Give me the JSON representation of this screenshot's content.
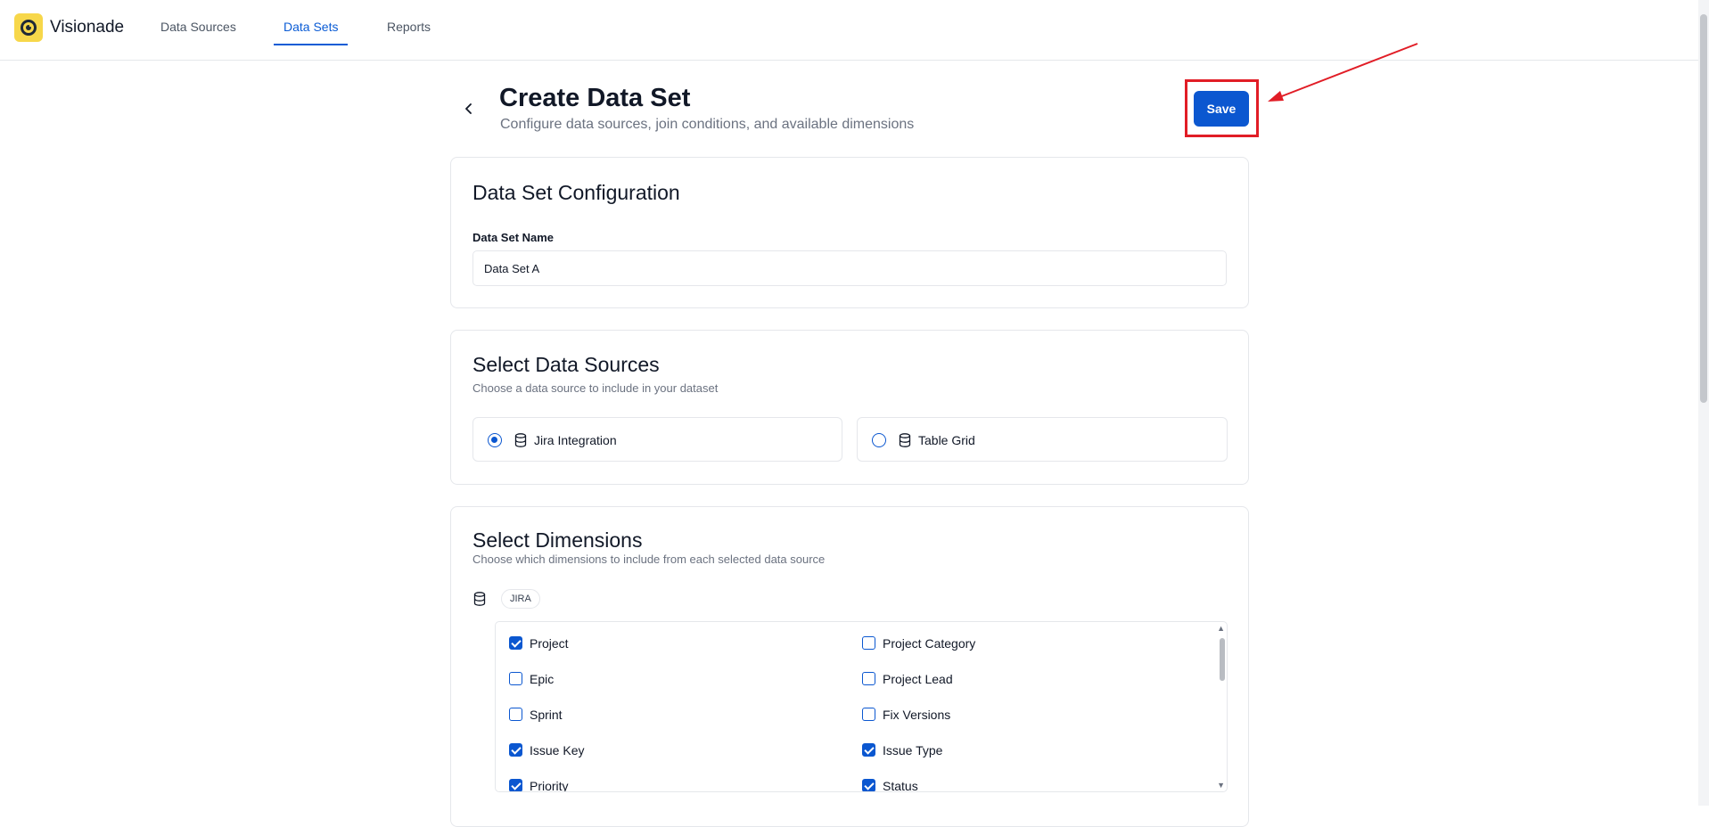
{
  "app": {
    "name": "Visionade"
  },
  "nav": {
    "tabs": [
      {
        "label": "Data Sources"
      },
      {
        "label": "Data Sets"
      },
      {
        "label": "Reports"
      }
    ],
    "active_tab": "Data Sets"
  },
  "header": {
    "title": "Create Data Set",
    "subtitle": "Configure data sources, join conditions, and available dimensions",
    "save_label": "Save"
  },
  "config": {
    "title": "Data Set Configuration",
    "name_label": "Data Set Name",
    "name_value": "Data Set A"
  },
  "sources": {
    "title": "Select Data Sources",
    "description": "Choose a data source to include in your dataset",
    "options": [
      {
        "label": "Jira Integration",
        "selected": true
      },
      {
        "label": "Table Grid",
        "selected": false
      }
    ]
  },
  "dimensions": {
    "title": "Select Dimensions",
    "description": "Choose which dimensions to include from each selected data source",
    "source_tag": "JIRA",
    "items": [
      {
        "label": "Project",
        "checked": true
      },
      {
        "label": "Project Category",
        "checked": false
      },
      {
        "label": "Epic",
        "checked": false
      },
      {
        "label": "Project Lead",
        "checked": false
      },
      {
        "label": "Sprint",
        "checked": false
      },
      {
        "label": "Fix Versions",
        "checked": false
      },
      {
        "label": "Issue Key",
        "checked": true
      },
      {
        "label": "Issue Type",
        "checked": true
      },
      {
        "label": "Priority",
        "checked": true
      },
      {
        "label": "Status",
        "checked": true
      }
    ]
  },
  "colors": {
    "accent": "#0b57d0",
    "annotation": "#e11d26",
    "logo_bg": "#f7d74a"
  }
}
